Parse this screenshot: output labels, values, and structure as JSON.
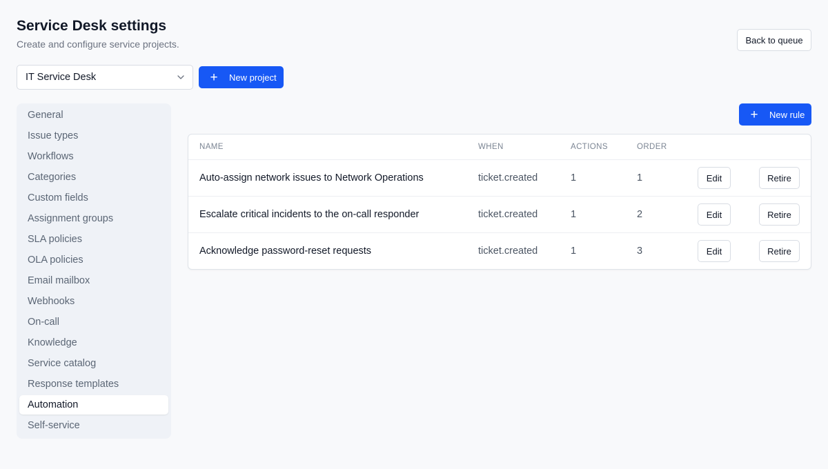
{
  "header": {
    "title": "Service Desk settings",
    "subtitle": "Create and configure service projects.",
    "back_label": "Back to queue"
  },
  "project": {
    "selected": "IT Service Desk",
    "new_project_label": "New project"
  },
  "sidebar": {
    "items": [
      {
        "label": "General"
      },
      {
        "label": "Issue types"
      },
      {
        "label": "Workflows"
      },
      {
        "label": "Categories"
      },
      {
        "label": "Custom fields"
      },
      {
        "label": "Assignment groups"
      },
      {
        "label": "SLA policies"
      },
      {
        "label": "OLA policies"
      },
      {
        "label": "Email mailbox"
      },
      {
        "label": "Webhooks"
      },
      {
        "label": "On-call"
      },
      {
        "label": "Knowledge"
      },
      {
        "label": "Service catalog"
      },
      {
        "label": "Response templates"
      },
      {
        "label": "Automation",
        "active": true
      },
      {
        "label": "Self-service"
      }
    ]
  },
  "rules": {
    "new_rule_label": "New rule",
    "columns": {
      "name": "NAME",
      "when": "WHEN",
      "actions": "ACTIONS",
      "order": "ORDER"
    },
    "rows": [
      {
        "name": "Auto-assign network issues to Network Operations",
        "when": "ticket.created",
        "actions": "1",
        "order": "1"
      },
      {
        "name": "Escalate critical incidents to the on-call responder",
        "when": "ticket.created",
        "actions": "1",
        "order": "2"
      },
      {
        "name": "Acknowledge password-reset requests",
        "when": "ticket.created",
        "actions": "1",
        "order": "3"
      }
    ],
    "edit_label": "Edit",
    "retire_label": "Retire"
  },
  "icons": {
    "plus": "plus-icon",
    "chevron": "chevron-down-icon"
  },
  "colors": {
    "primary": "#1758f5",
    "sidebar_bg": "#eff2f7",
    "page_bg": "#f8f9fb"
  }
}
